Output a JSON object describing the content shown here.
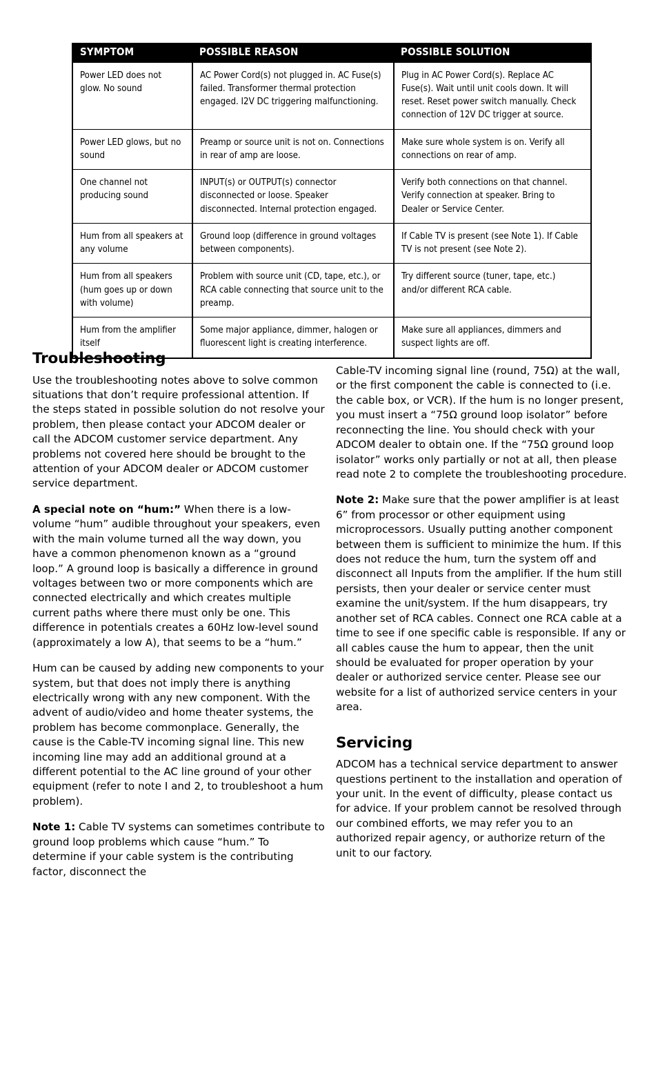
{
  "table": {
    "headers": [
      "SYMPTOM",
      "POSSIBLE REASON",
      "POSSIBLE SOLUTION"
    ],
    "rows": [
      {
        "symptom": "Power LED does not glow. No sound",
        "reason": "AC Power Cord(s) not plugged in. AC Fuse(s) failed. Transformer thermal protection engaged. I2V DC triggering malfunctioning.",
        "solution": "Plug in AC Power Cord(s). Replace AC Fuse(s). Wait until unit cools down. It will reset. Reset power switch manually. Check connection of 12V DC trigger at source."
      },
      {
        "symptom": "Power LED glows, but no sound",
        "reason": "Preamp or source unit is not on. Connections in rear of amp are loose.",
        "solution": "Make sure whole system is on. Verify all connections on rear of amp."
      },
      {
        "symptom": "One channel not producing sound",
        "reason": "INPUT(s) or OUTPUT(s) connector disconnected or loose. Speaker disconnected. Internal protection engaged.",
        "solution": "Verify both connections on that channel. Verify connection at speaker. Bring to Dealer or Service Center."
      },
      {
        "symptom": "Hum from all speakers at any volume",
        "reason": "Ground loop (difference in ground voltages between components).",
        "solution": "If Cable TV is present (see Note 1). If Cable TV is not present (see Note 2)."
      },
      {
        "symptom": "Hum from all speakers (hum goes up or down with volume)",
        "reason": "Problem with source unit (CD, tape, etc.), or RCA cable connecting that source unit to the preamp.",
        "solution": "Try different source (tuner, tape, etc.) and/or different RCA cable."
      },
      {
        "symptom": "Hum from the amplifier itself",
        "reason": "Some major appliance, dimmer, halogen or fluorescent light is creating interference.",
        "solution": "Make sure all appliances, dimmers and suspect lights are off."
      }
    ]
  },
  "troubleshooting": {
    "heading": "Troubleshooting",
    "intro": "Use the troubleshooting notes above to solve common situations that don’t require professional attention. If the steps stated in possible solution do not resolve your problem, then please contact your ADCOM dealer or call the ADCOM customer service department. Any problems not covered here should be brought to the attention of your ADCOM dealer or ADCOM customer service department.",
    "hum_note_lead": "A special note on “hum:”",
    "hum_note_body": " When there is a low-volume “hum” audible throughout your speakers, even with the main volume turned all the way down, you have a common phenomenon known as a “ground loop.” A ground loop is basically a difference in ground voltages between two or more components which are connected electrically and which creates multiple current paths where there must only be one. This difference in potentials creates a 60Hz low-level sound (approximately a low A), that seems to be a “hum.”",
    "hum_causes": "Hum can be caused by adding new components to your system, but that does not imply there is anything electrically wrong with any new component. With the advent of audio/video and home theater systems, the problem has become commonplace. Generally, the cause is the Cable-TV incoming signal line. This new incoming line may add an additional ground at a different potential to the AC line ground of your other equipment (refer to note I and 2, to troubleshoot a hum problem).",
    "note1_lead": "Note 1:",
    "note1_body": " Cable TV systems can sometimes contribute to ground loop problems which cause “hum.” To determine if your cable system is the contributing factor, disconnect the",
    "note1_continued": "Cable-TV incoming signal line (round, 75Ω) at the wall, or the first component the cable is connected to (i.e. the cable box, or VCR). If the hum is no longer present, you must insert a “75Ω ground loop isolator” before reconnecting the line. You should check with your ADCOM dealer to obtain one. If the “75Ω ground loop isolator” works only partially or not at all, then please read note 2 to complete the troubleshooting procedure.",
    "note2_lead": "Note 2:",
    "note2_body": " Make sure that the power amplifier is at least 6” from processor or other equipment using microprocessors. Usually putting another component between them is sufficient to minimize the hum. If this does not reduce the hum, turn the system off and disconnect all Inputs from the amplifier. If the hum still persists, then your dealer or service center must examine the unit/system. If the hum disappears, try another set of RCA cables. Connect one RCA cable at a time to see if one specific cable is responsible. If any or all cables cause the hum to appear, then the unit should be evaluated for proper operation by your dealer or authorized service center. Please see our website for a list of authorized service centers in your area."
  },
  "servicing": {
    "heading": "Servicing",
    "body": "ADCOM has a technical service department to answer questions pertinent to the installation and operation of your unit. In the event of difficulty, please contact us for advice. If your problem cannot be resolved through our combined efforts, we may refer you to an authorized repair agency, or authorize return of the unit to our factory."
  }
}
